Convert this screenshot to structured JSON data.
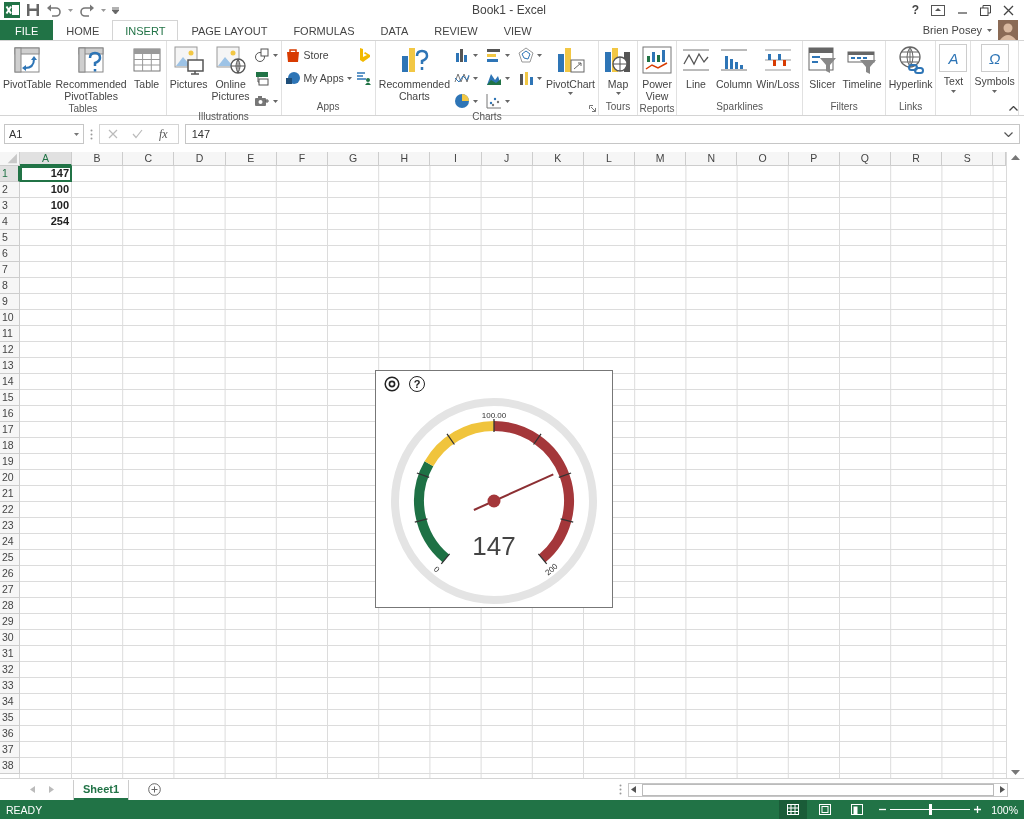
{
  "title_bar": {
    "title": "Book1 - Excel",
    "help": "?",
    "user": "Brien Posey"
  },
  "tabs": [
    {
      "label": "FILE",
      "kind": "file",
      "selected": false
    },
    {
      "label": "HOME",
      "kind": "tab",
      "selected": false
    },
    {
      "label": "INSERT",
      "kind": "tab",
      "selected": true
    },
    {
      "label": "PAGE LAYOUT",
      "kind": "tab",
      "selected": false
    },
    {
      "label": "FORMULAS",
      "kind": "tab",
      "selected": false
    },
    {
      "label": "DATA",
      "kind": "tab",
      "selected": false
    },
    {
      "label": "REVIEW",
      "kind": "tab",
      "selected": false
    },
    {
      "label": "VIEW",
      "kind": "tab",
      "selected": false
    }
  ],
  "ribbon": {
    "groups": [
      {
        "label": "Tables",
        "items": [
          {
            "kind": "large",
            "label": "PivotTable"
          },
          {
            "kind": "large",
            "label": "Recommended PivotTables"
          },
          {
            "kind": "large",
            "label": "Table"
          }
        ]
      },
      {
        "label": "Illustrations",
        "items": [
          {
            "kind": "large",
            "label": "Pictures"
          },
          {
            "kind": "large",
            "label": "Online Pictures"
          },
          {
            "kind": "stack",
            "items": [
              {
                "kind": "icon",
                "dropdown": true
              },
              {
                "kind": "icon",
                "dropdown": false
              },
              {
                "kind": "icon",
                "dropdown": true
              }
            ]
          }
        ]
      },
      {
        "label": "Apps",
        "items": [
          {
            "kind": "stack",
            "items": [
              {
                "kind": "small",
                "label": "Store",
                "dropdown": false
              },
              {
                "kind": "small",
                "label": "My Apps",
                "dropdown": true
              }
            ]
          },
          {
            "kind": "stack",
            "items": [
              {
                "kind": "icon",
                "dropdown": false
              },
              {
                "kind": "icon",
                "dropdown": false
              }
            ]
          }
        ]
      },
      {
        "label": "Charts",
        "launcher": true,
        "items": [
          {
            "kind": "large",
            "label": "Recommended Charts"
          },
          {
            "kind": "grid",
            "items": [
              {
                "kind": "icon",
                "dropdown": true
              },
              {
                "kind": "icon",
                "dropdown": true
              },
              {
                "kind": "icon",
                "dropdown": true
              },
              {
                "kind": "icon",
                "dropdown": true
              },
              {
                "kind": "icon",
                "dropdown": true
              },
              {
                "kind": "icon",
                "dropdown": true
              },
              {
                "kind": "icon",
                "dropdown": true
              },
              {
                "kind": "icon",
                "dropdown": true
              }
            ]
          },
          {
            "kind": "large",
            "label": "PivotChart",
            "dropdown": true
          }
        ]
      },
      {
        "label": "Tours",
        "items": [
          {
            "kind": "large",
            "label": "Map",
            "dropdown": true
          }
        ]
      },
      {
        "label": "Reports",
        "items": [
          {
            "kind": "large",
            "label": "Power View"
          }
        ]
      },
      {
        "label": "Sparklines",
        "items": [
          {
            "kind": "large",
            "label": "Line"
          },
          {
            "kind": "large",
            "label": "Column"
          },
          {
            "kind": "large",
            "label": "Win/Loss"
          }
        ]
      },
      {
        "label": "Filters",
        "items": [
          {
            "kind": "large",
            "label": "Slicer"
          },
          {
            "kind": "large",
            "label": "Timeline"
          }
        ]
      },
      {
        "label": "Links",
        "items": [
          {
            "kind": "large",
            "label": "Hyperlink"
          }
        ]
      },
      {
        "items": [
          {
            "kind": "glyph",
            "glyph": "A",
            "label": "Text",
            "dropdown": true
          }
        ]
      },
      {
        "items": [
          {
            "kind": "glyph",
            "glyph": "Ω",
            "label": "Symbols",
            "dropdown": true
          }
        ]
      }
    ]
  },
  "formula_bar": {
    "name_box": "A1",
    "function_label": "fx",
    "formula": "147"
  },
  "sheet": {
    "columns": [
      {
        "label": "A",
        "selected": true
      },
      {
        "label": "B",
        "selected": false
      },
      {
        "label": "C",
        "selected": false
      },
      {
        "label": "D",
        "selected": false
      },
      {
        "label": "E",
        "selected": false
      },
      {
        "label": "F",
        "selected": false
      },
      {
        "label": "G",
        "selected": false
      },
      {
        "label": "H",
        "selected": false
      },
      {
        "label": "I",
        "selected": false
      },
      {
        "label": "J",
        "selected": false
      },
      {
        "label": "K",
        "selected": false
      },
      {
        "label": "L",
        "selected": false
      },
      {
        "label": "M",
        "selected": false
      },
      {
        "label": "N",
        "selected": false
      },
      {
        "label": "O",
        "selected": false
      },
      {
        "label": "P",
        "selected": false
      },
      {
        "label": "Q",
        "selected": false
      },
      {
        "label": "R",
        "selected": false
      },
      {
        "label": "S",
        "selected": false
      }
    ],
    "rows": [
      {
        "label": "1",
        "selected": true,
        "cells": [
          "147"
        ]
      },
      {
        "label": "2",
        "selected": false,
        "cells": [
          "100"
        ]
      },
      {
        "label": "3",
        "selected": false,
        "cells": [
          "100"
        ]
      },
      {
        "label": "4",
        "selected": false,
        "cells": [
          "254"
        ]
      },
      {
        "label": "5",
        "selected": false
      },
      {
        "label": "6",
        "selected": false
      },
      {
        "label": "7",
        "selected": false
      },
      {
        "label": "8",
        "selected": false
      },
      {
        "label": "9",
        "selected": false
      },
      {
        "label": "10",
        "selected": false
      },
      {
        "label": "11",
        "selected": false
      },
      {
        "label": "12",
        "selected": false
      },
      {
        "label": "13",
        "selected": false
      },
      {
        "label": "14",
        "selected": false
      },
      {
        "label": "15",
        "selected": false
      },
      {
        "label": "16",
        "selected": false
      },
      {
        "label": "17",
        "selected": false
      },
      {
        "label": "18",
        "selected": false
      },
      {
        "label": "19",
        "selected": false
      },
      {
        "label": "20",
        "selected": false
      },
      {
        "label": "21",
        "selected": false
      },
      {
        "label": "22",
        "selected": false
      },
      {
        "label": "23",
        "selected": false
      },
      {
        "label": "24",
        "selected": false
      },
      {
        "label": "25",
        "selected": false
      },
      {
        "label": "26",
        "selected": false
      },
      {
        "label": "27",
        "selected": false
      },
      {
        "label": "28",
        "selected": false
      },
      {
        "label": "29",
        "selected": false
      },
      {
        "label": "30",
        "selected": false
      },
      {
        "label": "31",
        "selected": false
      },
      {
        "label": "32",
        "selected": false
      },
      {
        "label": "33",
        "selected": false
      },
      {
        "label": "34",
        "selected": false
      },
      {
        "label": "35",
        "selected": false
      },
      {
        "label": "36",
        "selected": false
      },
      {
        "label": "37",
        "selected": false
      },
      {
        "label": "38",
        "selected": false
      }
    ]
  },
  "gauge": {
    "help": "?",
    "min_label": "0",
    "mid_label": "100.00",
    "max_label": "200",
    "value": "147",
    "bands": [
      {
        "color": "#1e7145"
      },
      {
        "color": "#f0c43c"
      },
      {
        "color": "#a4373a"
      }
    ]
  },
  "sheet_tabs": [
    {
      "label": "Sheet1",
      "selected": true
    }
  ],
  "status_bar": {
    "status": "READY",
    "views": [
      {
        "kind": "normal",
        "selected": true
      },
      {
        "kind": "page_layout",
        "selected": false
      },
      {
        "kind": "page_break",
        "selected": false
      }
    ],
    "zoom_slider": {
      "level": 0.5
    },
    "zoom": "100%"
  }
}
